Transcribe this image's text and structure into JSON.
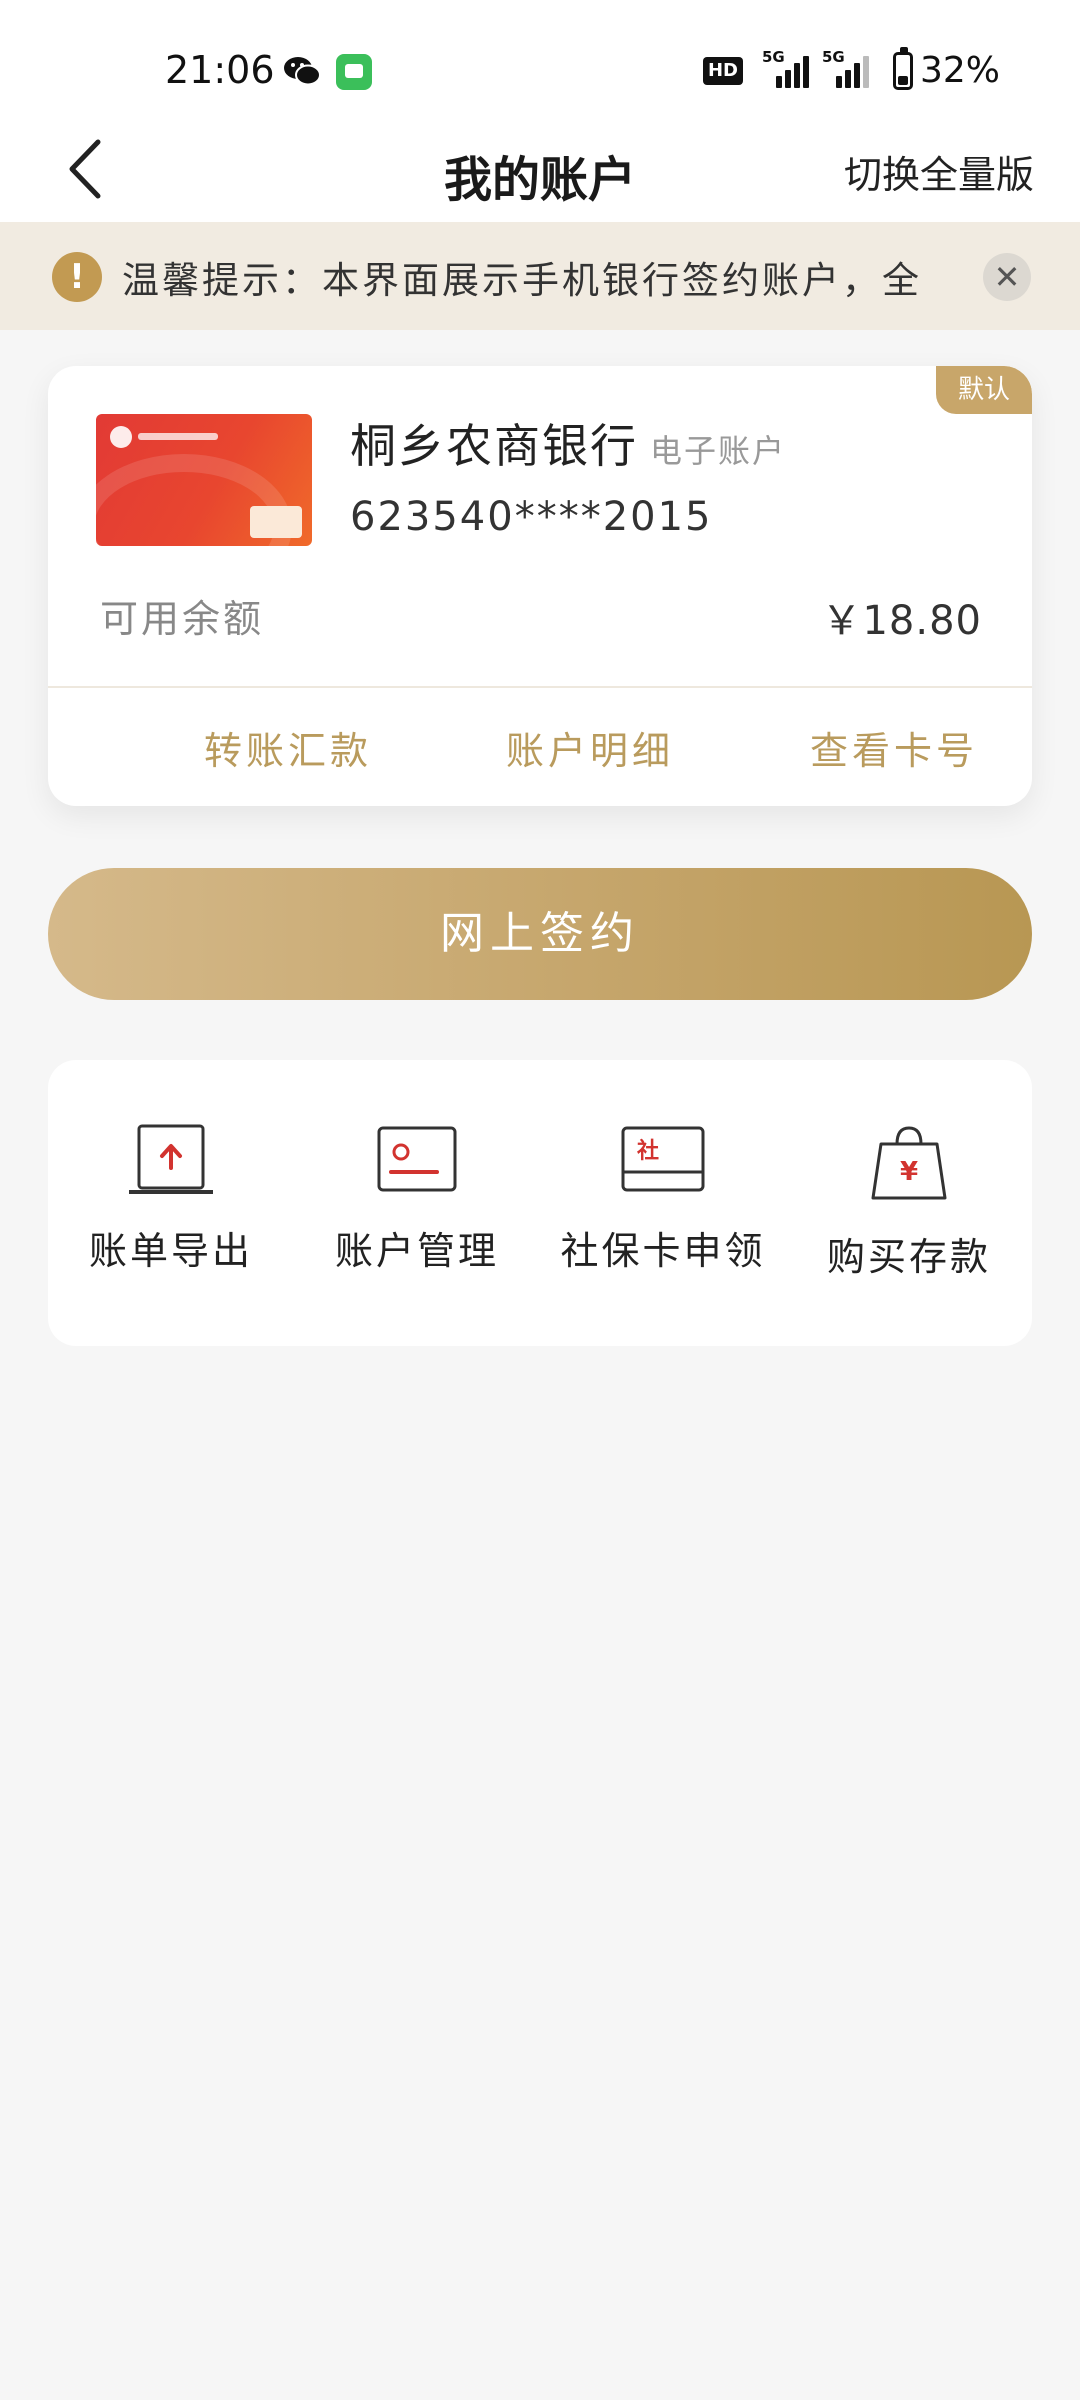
{
  "status_bar": {
    "time": "21:06",
    "network_1": "5G",
    "network_2": "5G",
    "hd_label": "HD",
    "battery": "32%",
    "battery_level": 0.32
  },
  "nav": {
    "title": "我的账户",
    "switch_label": "切换全量版"
  },
  "notice": {
    "text": "温馨提示：本界面展示手机银行签约账户，全",
    "close_symbol": "✕"
  },
  "account": {
    "bank_name": "桐乡农商银行",
    "account_type": "电子账户",
    "card_number": "623540****2015",
    "default_badge": "默认",
    "balance_label": "可用余额",
    "balance_value": "￥18.80",
    "actions": [
      "转账汇款",
      "账户明细",
      "查看卡号"
    ]
  },
  "sign_button": "网上签约",
  "services": [
    {
      "label": "账单导出",
      "icon": "laptop-upload-icon"
    },
    {
      "label": "账户管理",
      "icon": "id-card-icon"
    },
    {
      "label": "社保卡申领",
      "icon": "social-security-card-icon",
      "icon_text": "社"
    },
    {
      "label": "购买存款",
      "icon": "shopping-bag-yuan-icon",
      "icon_text": "¥"
    }
  ],
  "colors": {
    "accent_gold": "#c8a66a",
    "icon_red": "#d2332f",
    "background": "#f6f6f6"
  }
}
